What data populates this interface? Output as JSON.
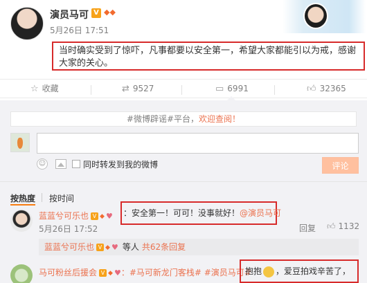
{
  "post": {
    "author": "演员马可",
    "verified_badge": "V",
    "vip_label": "",
    "time": "5月26日 17:51",
    "text": "当时确实受到了惊吓，凡事都要以安全第一，希望大家都能引以为戒，感谢大家的关心。"
  },
  "actions": {
    "favorite_icon": "star-icon",
    "favorite_label": "收藏",
    "repost_icon": "repost-icon",
    "repost_count": "9527",
    "comment_icon": "comment-icon",
    "comment_count": "6991",
    "like_icon": "thumbs-up-icon",
    "like_count": "32365"
  },
  "composer": {
    "rumor_prefix": "#微博辟谣#平台，",
    "rumor_link": "欢迎查阅！",
    "input_value": "",
    "forward_label": "同时转发到我的微博",
    "submit_label": "评论"
  },
  "sort": {
    "hot_label": "按热度",
    "time_label": "按时间"
  },
  "comments": [
    {
      "user": "蓝蓝兮可乐也",
      "text_prefix": "：安全第一！可可！没事就好！",
      "mention": "@演员马可",
      "time": "5月26日 17:52",
      "reply_label": "回复",
      "like_count": "1132",
      "sub_reply_user": "蓝蓝兮可乐也",
      "sub_reply_others": "等人",
      "sub_reply_count": "共62条回复"
    },
    {
      "user": "马可粉丝后援会",
      "topic": "：#马可新龙门客栈# #演员马可#",
      "text_a": "抱抱",
      "text_b": "，爱豆拍戏辛苦了，"
    }
  ],
  "colors": {
    "accent": "#eb7350",
    "highlight_border": "#d72a2a",
    "submit_bg": "#ffc09f",
    "panel_bg": "#f2f2f5"
  }
}
